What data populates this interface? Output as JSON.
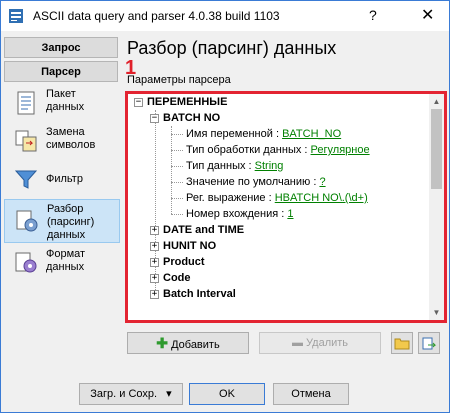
{
  "window": {
    "title": "ASCII data query and parser 4.0.38 build 1103",
    "help": "?",
    "close": "✕"
  },
  "sidebar": {
    "tab_query": "Запрос",
    "tab_parser": "Парсер",
    "items": [
      {
        "line1": "Пакет",
        "line2": "данных"
      },
      {
        "line1": "Замена",
        "line2": "символов"
      },
      {
        "line1": "Фильтр",
        "line2": ""
      },
      {
        "line1": "Разбор",
        "line2": "(парсинг)",
        "line3": "данных"
      },
      {
        "line1": "Формат",
        "line2": "данных"
      }
    ]
  },
  "main": {
    "heading": "Разбор (парсинг) данных",
    "params_label": "Параметры парсера",
    "marker": "1"
  },
  "tree": {
    "root": "ПЕРЕМЕННЫЕ",
    "batch_no": "BATCH NO",
    "props": [
      {
        "label": "Имя переменной : ",
        "value": "BATCH_NO"
      },
      {
        "label": "Тип обработки данных : ",
        "value": "Регулярное"
      },
      {
        "label": "Тип данных : ",
        "value": "String"
      },
      {
        "label": "Значение по умолчанию : ",
        "value": "?"
      },
      {
        "label": "Рег. выражение : ",
        "value": "HBATCH NO\\.(\\d+)"
      },
      {
        "label": "Номер вхождения : ",
        "value": "1"
      }
    ],
    "nodes": [
      "DATE and TIME",
      "HUNIT NO",
      "Product",
      "Code",
      "Batch Interval"
    ]
  },
  "buttons": {
    "add": "Добавить",
    "delete": "Удалить",
    "load_save": "Загр. и Сохр.",
    "ok": "OK",
    "cancel": "Отмена"
  },
  "colors": {
    "accent_red": "#e32432",
    "link_green": "#008000",
    "selection": "#cce4f7"
  }
}
